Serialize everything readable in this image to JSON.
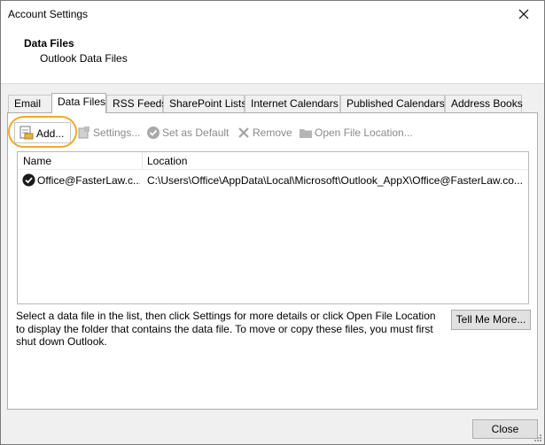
{
  "window": {
    "title": "Account Settings"
  },
  "header": {
    "title": "Data Files",
    "subtitle": "Outlook Data Files"
  },
  "tabs": [
    {
      "label": "Email"
    },
    {
      "label": "Data Files",
      "active": true
    },
    {
      "label": "RSS Feeds"
    },
    {
      "label": "SharePoint Lists"
    },
    {
      "label": "Internet Calendars"
    },
    {
      "label": "Published Calendars"
    },
    {
      "label": "Address Books"
    }
  ],
  "toolbar": {
    "add": "Add...",
    "settings": "Settings...",
    "set_default": "Set as Default",
    "remove": "Remove",
    "open_location": "Open File Location..."
  },
  "list": {
    "columns": [
      "Name",
      "Location"
    ],
    "rows": [
      {
        "name": "Office@FasterLaw.c...",
        "location": "C:\\Users\\Office\\AppData\\Local\\Microsoft\\Outlook_AppX\\Office@FasterLaw.co..."
      }
    ]
  },
  "description": "Select a data file in the list, then click Settings for more details or click Open File Location to display the folder that contains the data file. To move or copy these files, you must first shut down Outlook.",
  "buttons": {
    "tell_me_more": "Tell Me More...",
    "close": "Close"
  },
  "colors": {
    "highlight": "#f0a928",
    "disabled_text": "#8a8a8a"
  }
}
